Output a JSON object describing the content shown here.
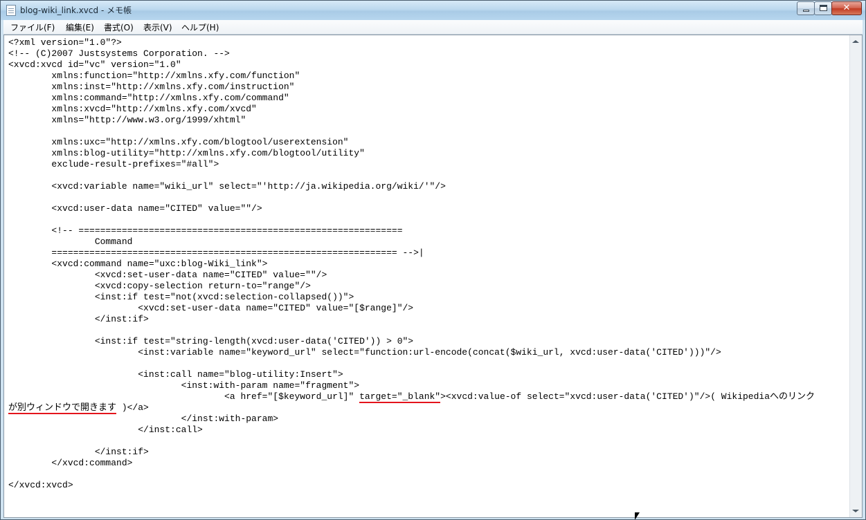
{
  "window": {
    "title": "blog-wiki_link.xvcd - メモ帳"
  },
  "menu": [
    "ファイル(F)",
    "編集(E)",
    "書式(O)",
    "表示(V)",
    "ヘルプ(H)"
  ],
  "editor": {
    "lines": [
      "<?xml version=\"1.0\"?>",
      "<!-- (C)2007 Justsystems Corporation. -->",
      "<xvcd:xvcd id=\"vc\" version=\"1.0\"",
      "        xmlns:function=\"http://xmlns.xfy.com/function\"",
      "        xmlns:inst=\"http://xmlns.xfy.com/instruction\"",
      "        xmlns:command=\"http://xmlns.xfy.com/command\"",
      "        xmlns:xvcd=\"http://xmlns.xfy.com/xvcd\"",
      "        xmlns=\"http://www.w3.org/1999/xhtml\"",
      "",
      "        xmlns:uxc=\"http://xmlns.xfy.com/blogtool/userextension\"",
      "        xmlns:blog-utility=\"http://xmlns.xfy.com/blogtool/utility\"",
      "        exclude-result-prefixes=\"#all\">",
      "",
      "        <xvcd:variable name=\"wiki_url\" select=\"'http://ja.wikipedia.org/wiki/'\"/>",
      "",
      "        <xvcd:user-data name=\"CITED\" value=\"\"/>",
      "",
      "        <!-- ============================================================",
      "                Command",
      "        ================================================================ -->|",
      "        <xvcd:command name=\"uxc:blog-Wiki_link\">",
      "                <xvcd:set-user-data name=\"CITED\" value=\"\"/>",
      "                <xvcd:copy-selection return-to=\"range\"/>",
      "                <inst:if test=\"not(xvcd:selection-collapsed())\">",
      "                        <xvcd:set-user-data name=\"CITED\" value=\"[$range]\"/>",
      "                </inst:if>",
      "",
      "                <inst:if test=\"string-length(xvcd:user-data('CITED')) > 0\">",
      "                        <inst:variable name=\"keyword_url\" select=\"function:url-encode(concat($wiki_url, xvcd:user-data('CITED')))\"/>",
      "",
      "                        <inst:call name=\"blog-utility:Insert\">",
      "                                <inst:with-param name=\"fragment\">"
    ],
    "wrap_line": {
      "before": "                                        <a href=\"[$keyword_url]\" ",
      "target": "target=\"_blank\"",
      "after": "><xvcd:value-of select=\"xvcd:user-data('CITED')\"/>( Wikipediaへのリンク",
      "cont_marked": "が別ウィンドウで開きます",
      "cont_rest": " )</a>"
    },
    "tail_lines": [
      "                                </inst:with-param>",
      "                        </inst:call>",
      "",
      "                </inst:if>",
      "        </xvcd:command>",
      "",
      "</xvcd:xvcd>"
    ]
  },
  "colors": {
    "highlight_underline": "#e4141c"
  },
  "icons": {
    "title_icon": "notepad-icon",
    "minimize": "minimize-icon",
    "maximize": "maximize-icon",
    "close": "close-icon"
  }
}
